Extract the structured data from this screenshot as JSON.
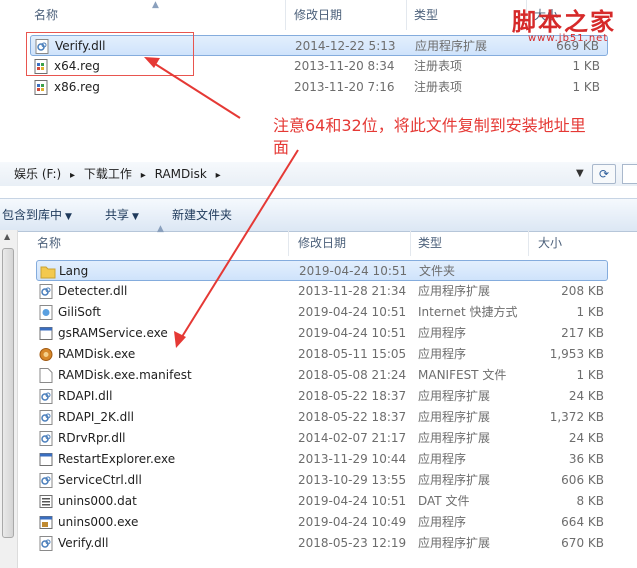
{
  "watermark": {
    "title": "脚本之家",
    "url": "www.jb51.net"
  },
  "annotation": {
    "line1": "注意64和32位，将此文件复制到安装地址里",
    "line2": "面"
  },
  "top_pane": {
    "columns": {
      "name": "名称",
      "date": "修改日期",
      "type": "类型",
      "size": "大小"
    },
    "files": [
      {
        "name": "Verify.dll",
        "date": "2014-12-22 5:13",
        "type": "应用程序扩展",
        "size": "669 KB",
        "icon": "dll-file-icon",
        "selected": true
      },
      {
        "name": "x64.reg",
        "date": "2013-11-20 8:34",
        "type": "注册表项",
        "size": "1 KB",
        "icon": "reg-file-icon",
        "selected": false
      },
      {
        "name": "x86.reg",
        "date": "2013-11-20 7:16",
        "type": "注册表项",
        "size": "1 KB",
        "icon": "reg-file-icon",
        "selected": false
      }
    ]
  },
  "bottom_window": {
    "breadcrumb": [
      "娱乐 (F:)",
      "下载工作",
      "RAMDisk"
    ],
    "toolbar": {
      "include_library": "包含到库中",
      "share": "共享",
      "new_folder": "新建文件夹"
    },
    "columns": {
      "name": "名称",
      "date": "修改日期",
      "type": "类型",
      "size": "大小"
    },
    "files": [
      {
        "name": "Lang",
        "date": "2019-04-24 10:51",
        "type": "文件夹",
        "size": "",
        "icon": "folder-icon",
        "selected": true
      },
      {
        "name": "Detecter.dll",
        "date": "2013-11-28 21:34",
        "type": "应用程序扩展",
        "size": "208 KB",
        "icon": "dll-file-icon",
        "selected": false
      },
      {
        "name": "GiliSoft",
        "date": "2019-04-24 10:51",
        "type": "Internet 快捷方式",
        "size": "1 KB",
        "icon": "internet-shortcut-icon",
        "selected": false
      },
      {
        "name": "gsRAMService.exe",
        "date": "2019-04-24 10:51",
        "type": "应用程序",
        "size": "217 KB",
        "icon": "exe-file-icon",
        "selected": false
      },
      {
        "name": "RAMDisk.exe",
        "date": "2018-05-11 15:05",
        "type": "应用程序",
        "size": "1,953 KB",
        "icon": "ramdisk-app-icon",
        "selected": false
      },
      {
        "name": "RAMDisk.exe.manifest",
        "date": "2018-05-08 21:24",
        "type": "MANIFEST 文件",
        "size": "1 KB",
        "icon": "blank-file-icon",
        "selected": false
      },
      {
        "name": "RDAPI.dll",
        "date": "2018-05-22 18:37",
        "type": "应用程序扩展",
        "size": "24 KB",
        "icon": "dll-file-icon",
        "selected": false
      },
      {
        "name": "RDAPI_2K.dll",
        "date": "2018-05-22 18:37",
        "type": "应用程序扩展",
        "size": "1,372 KB",
        "icon": "dll-file-icon",
        "selected": false
      },
      {
        "name": "RDrvRpr.dll",
        "date": "2014-02-07 21:17",
        "type": "应用程序扩展",
        "size": "24 KB",
        "icon": "dll-file-icon",
        "selected": false
      },
      {
        "name": "RestartExplorer.exe",
        "date": "2013-11-29 10:44",
        "type": "应用程序",
        "size": "36 KB",
        "icon": "exe-file-icon",
        "selected": false
      },
      {
        "name": "ServiceCtrl.dll",
        "date": "2013-10-29 13:55",
        "type": "应用程序扩展",
        "size": "606 KB",
        "icon": "dll-file-icon",
        "selected": false
      },
      {
        "name": "unins000.dat",
        "date": "2019-04-24 10:51",
        "type": "DAT 文件",
        "size": "8 KB",
        "icon": "dat-file-icon",
        "selected": false
      },
      {
        "name": "unins000.exe",
        "date": "2019-04-24 10:49",
        "type": "应用程序",
        "size": "664 KB",
        "icon": "installer-exe-icon",
        "selected": false
      },
      {
        "name": "Verify.dll",
        "date": "2018-05-23 12:19",
        "type": "应用程序扩展",
        "size": "670 KB",
        "icon": "dll-file-icon",
        "selected": false
      }
    ]
  },
  "colors": {
    "annotation_red": "#e53935",
    "selection_border": "#84acdd",
    "header_text": "#4c607a"
  }
}
